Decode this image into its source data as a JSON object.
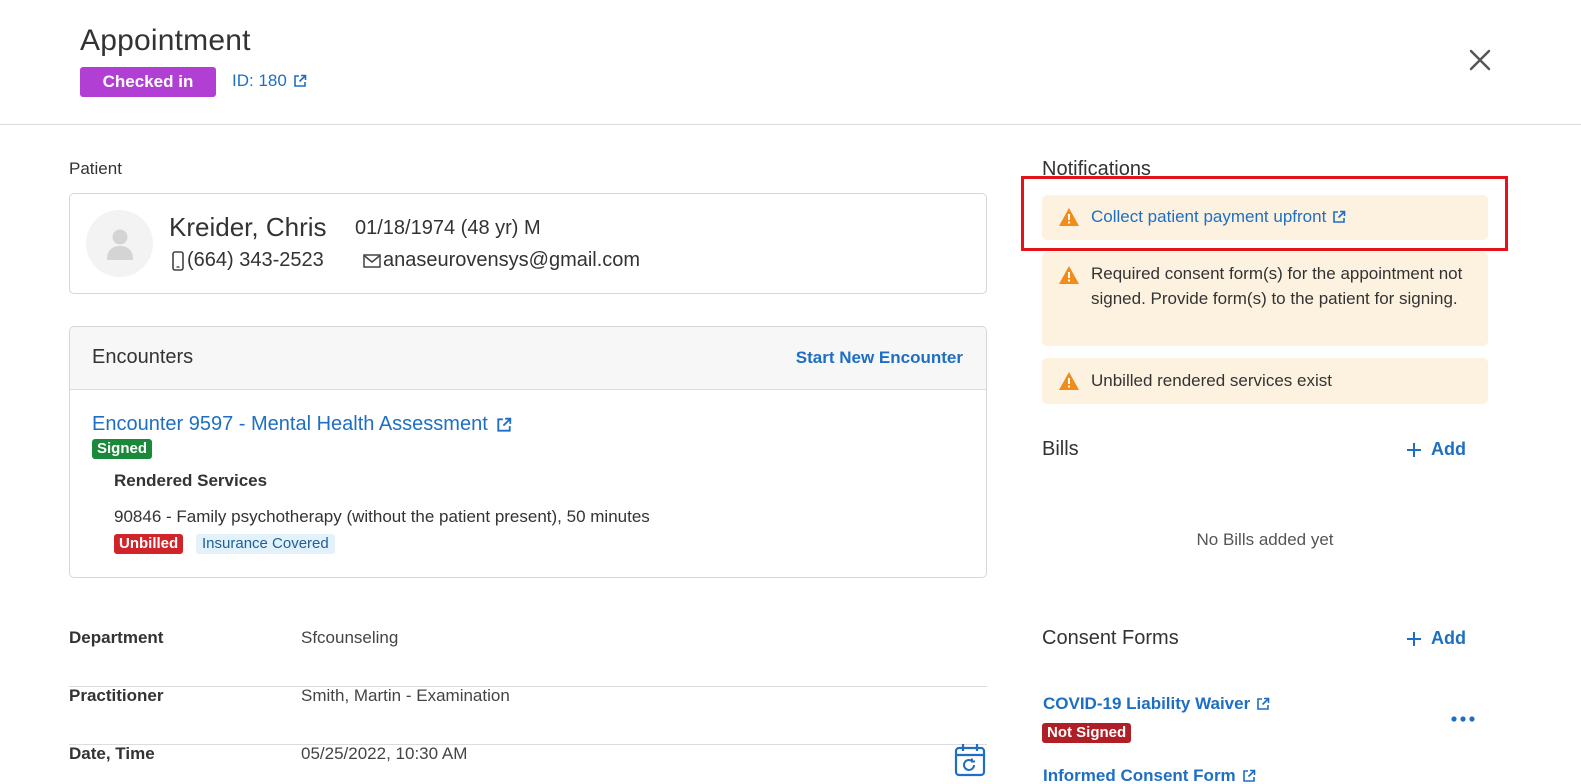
{
  "header": {
    "title": "Appointment",
    "status": "Checked in",
    "id_label": "ID: 180"
  },
  "patient": {
    "section_label": "Patient",
    "name": "Kreider, Chris",
    "dob": "01/18/1974 (48 yr) M",
    "phone": "(664) 343-2523",
    "email": "anaseurovensys@gmail.com"
  },
  "encounters": {
    "title": "Encounters",
    "start_new": "Start New Encounter",
    "encounter_link": "Encounter 9597 - Mental Health Assessment",
    "encounter_status": "Signed",
    "rendered_services_title": "Rendered Services",
    "service": "90846 - Family psychotherapy (without the patient present), 50 minutes",
    "billing_status": "Unbilled",
    "coverage": "Insurance Covered"
  },
  "details": [
    {
      "label": "Department",
      "value": "Sfcounseling"
    },
    {
      "label": "Practitioner",
      "value": "Smith, Martin - Examination"
    },
    {
      "label": "Date, Time",
      "value": "05/25/2022, 10:30 AM"
    }
  ],
  "notifications": {
    "title": "Notifications",
    "items": [
      "Collect patient payment upfront",
      "Required consent form(s) for the appointment not signed. Provide form(s) to the patient for signing.",
      "Unbilled rendered services exist"
    ]
  },
  "bills": {
    "title": "Bills",
    "add_label": "Add",
    "empty": "No Bills added yet"
  },
  "consent_forms": {
    "title": "Consent Forms",
    "add_label": "Add",
    "items": [
      {
        "name": "COVID-19 Liability Waiver",
        "status": "Not Signed"
      },
      {
        "name": "Informed Consent Form"
      }
    ]
  },
  "colors": {
    "accent": "#1e6fc4",
    "checked_in": "#b13fd3",
    "signed": "#1a8a3a",
    "unbilled": "#d0232a",
    "not_signed": "#b11f26",
    "warning_bg": "#fdf2e0",
    "warning_icon": "#f08c1a",
    "highlight": "#e3131b"
  }
}
